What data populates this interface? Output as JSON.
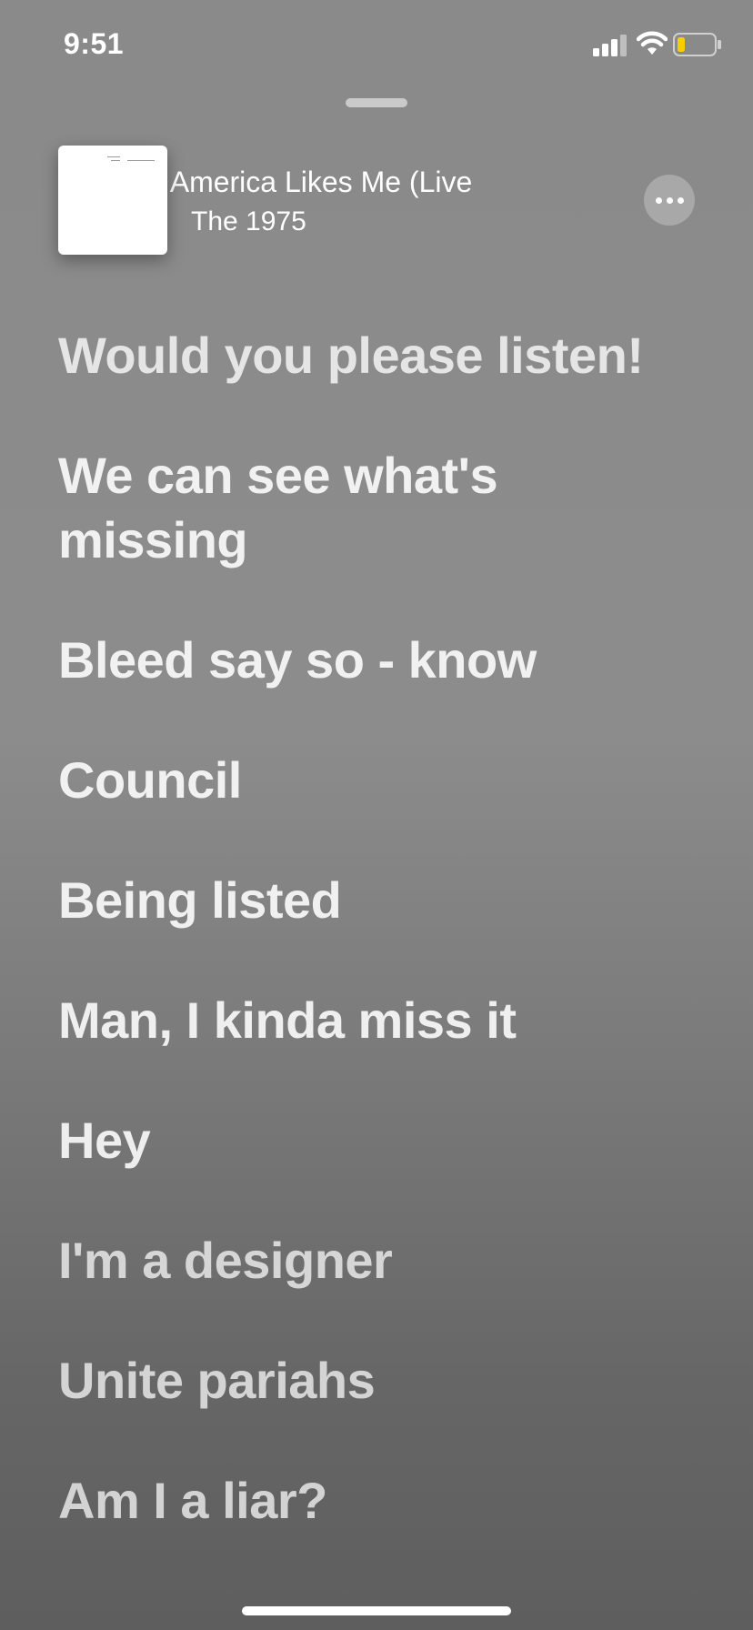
{
  "status_bar": {
    "time": "9:51",
    "battery_color": "#f5d000"
  },
  "now_playing": {
    "title": "America & America Likes Me (Live",
    "artist": "The 1975"
  },
  "lyrics": [
    "Would you please listen!",
    "We can see what's missing",
    "Bleed say so - know",
    "Council",
    "Being listed",
    "Man, I kinda miss it",
    "Hey",
    "I'm a designer",
    "Unite pariahs",
    "Am I a liar?"
  ],
  "icons": {
    "signal": "cellular-signal-icon",
    "wifi": "wifi-icon",
    "battery": "battery-icon",
    "more": "ellipsis-icon"
  }
}
